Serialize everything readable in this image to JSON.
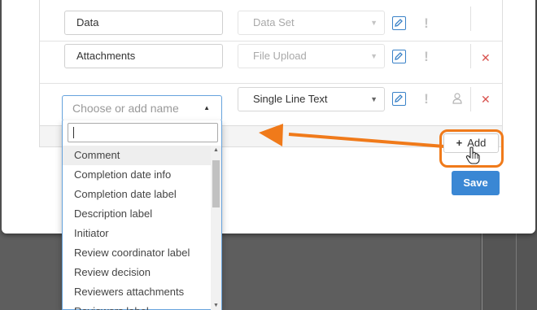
{
  "rows": [
    {
      "name": "Data",
      "type": "Data Set",
      "type_disabled": true,
      "edit_icon": "pencil-icon",
      "required_icon": "exclamation-icon"
    },
    {
      "name": "Attachments",
      "type": "File Upload",
      "type_disabled": true,
      "edit_icon": "pencil-icon",
      "required_icon": "exclamation-icon",
      "delete_icon": "close-icon"
    },
    {
      "name_placeholder": "Choose or add name",
      "type": "Single Line Text",
      "type_disabled": false,
      "edit_icon": "pencil-icon",
      "required_icon": "exclamation-icon",
      "person_icon": "person-icon",
      "delete_icon": "close-icon"
    }
  ],
  "dropdown": {
    "search_value": "",
    "items": [
      "Comment",
      "Completion date info",
      "Completion date label",
      "Description label",
      "Initiator",
      "Review coordinator label",
      "Review decision",
      "Reviewers attachments",
      "Reviewers label"
    ],
    "active_index": 0
  },
  "buttons": {
    "add_label": "Add",
    "save_label": "Save"
  },
  "colors": {
    "accent": "#3a87d4",
    "highlight": "#f07a1a",
    "delete": "#d9534f"
  }
}
